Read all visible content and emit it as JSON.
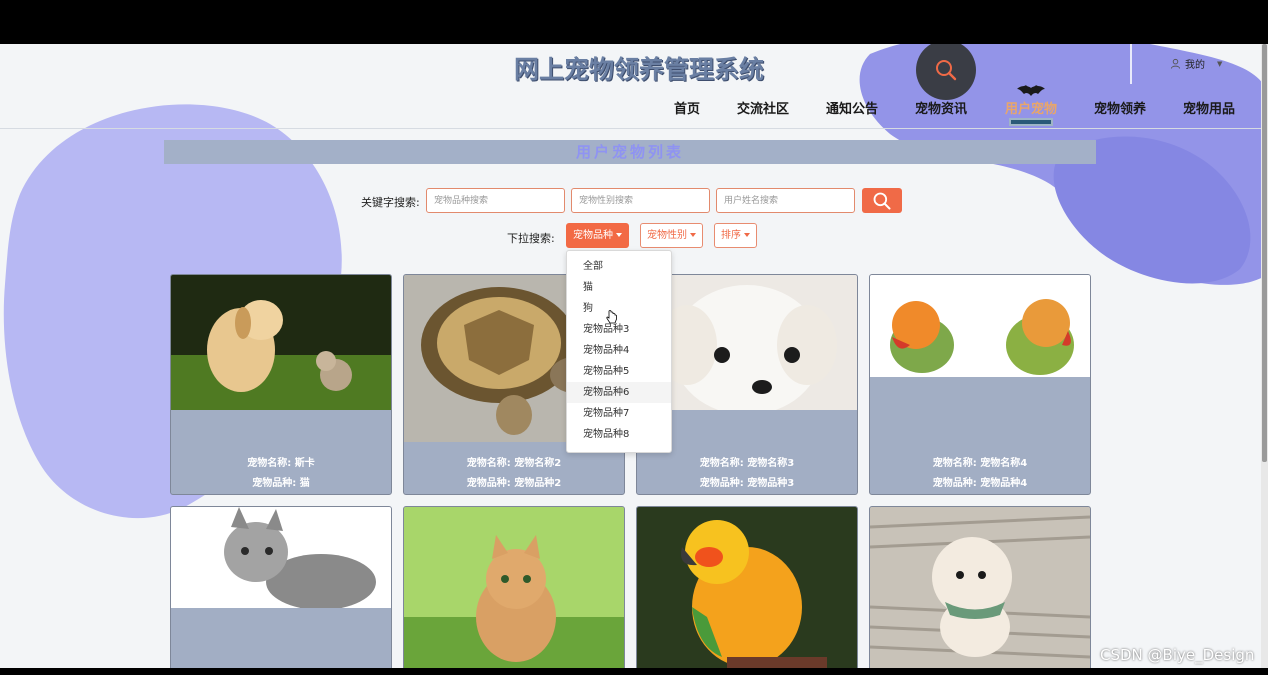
{
  "site": {
    "title": "网上宠物领养管理系统"
  },
  "user_menu": {
    "label": "我的"
  },
  "nav": [
    {
      "label": "首页"
    },
    {
      "label": "交流社区"
    },
    {
      "label": "通知公告"
    },
    {
      "label": "宠物资讯"
    },
    {
      "label": "用户宠物",
      "active": true
    },
    {
      "label": "宠物领养"
    },
    {
      "label": "宠物用品"
    }
  ],
  "section": {
    "title": "用户宠物列表"
  },
  "search": {
    "label": "关键字搜索:",
    "fields": [
      {
        "placeholder": "宠物品种搜索",
        "value": ""
      },
      {
        "placeholder": "宠物性别搜索",
        "value": ""
      },
      {
        "placeholder": "用户姓名搜索",
        "value": ""
      }
    ]
  },
  "filters": {
    "label": "下拉搜索:",
    "buttons": [
      {
        "label": "宠物品种",
        "active": true
      },
      {
        "label": "宠物性别",
        "active": false
      },
      {
        "label": "排序",
        "active": false
      }
    ],
    "dropdown_items": [
      "全部",
      "猫",
      "狗",
      "宠物品种3",
      "宠物品种4",
      "宠物品种5",
      "宠物品种6",
      "宠物品种7",
      "宠物品种8"
    ]
  },
  "cards": [
    {
      "name_line": "宠物名称: 斯卡",
      "breed_line": "宠物品种: 猫"
    },
    {
      "name_line": "宠物名称: 宠物名称2",
      "breed_line": "宠物品种: 宠物品种2"
    },
    {
      "name_line": "宠物名称: 宠物名称3",
      "breed_line": "宠物品种: 宠物品种3"
    },
    {
      "name_line": "宠物名称: 宠物名称4",
      "breed_line": "宠物品种: 宠物品种4"
    },
    {
      "name_line": "",
      "breed_line": ""
    },
    {
      "name_line": "",
      "breed_line": ""
    },
    {
      "name_line": "",
      "breed_line": ""
    },
    {
      "name_line": "",
      "breed_line": ""
    }
  ],
  "watermark": "CSDN @Biye_Design",
  "colors": {
    "accent": "#f26a45",
    "card_bg": "#a2aec4",
    "blob": "#9b9bec",
    "title": "#6a7fa3"
  },
  "icons": {
    "search": "search-icon",
    "user": "user-icon",
    "bat": "bat-icon"
  }
}
